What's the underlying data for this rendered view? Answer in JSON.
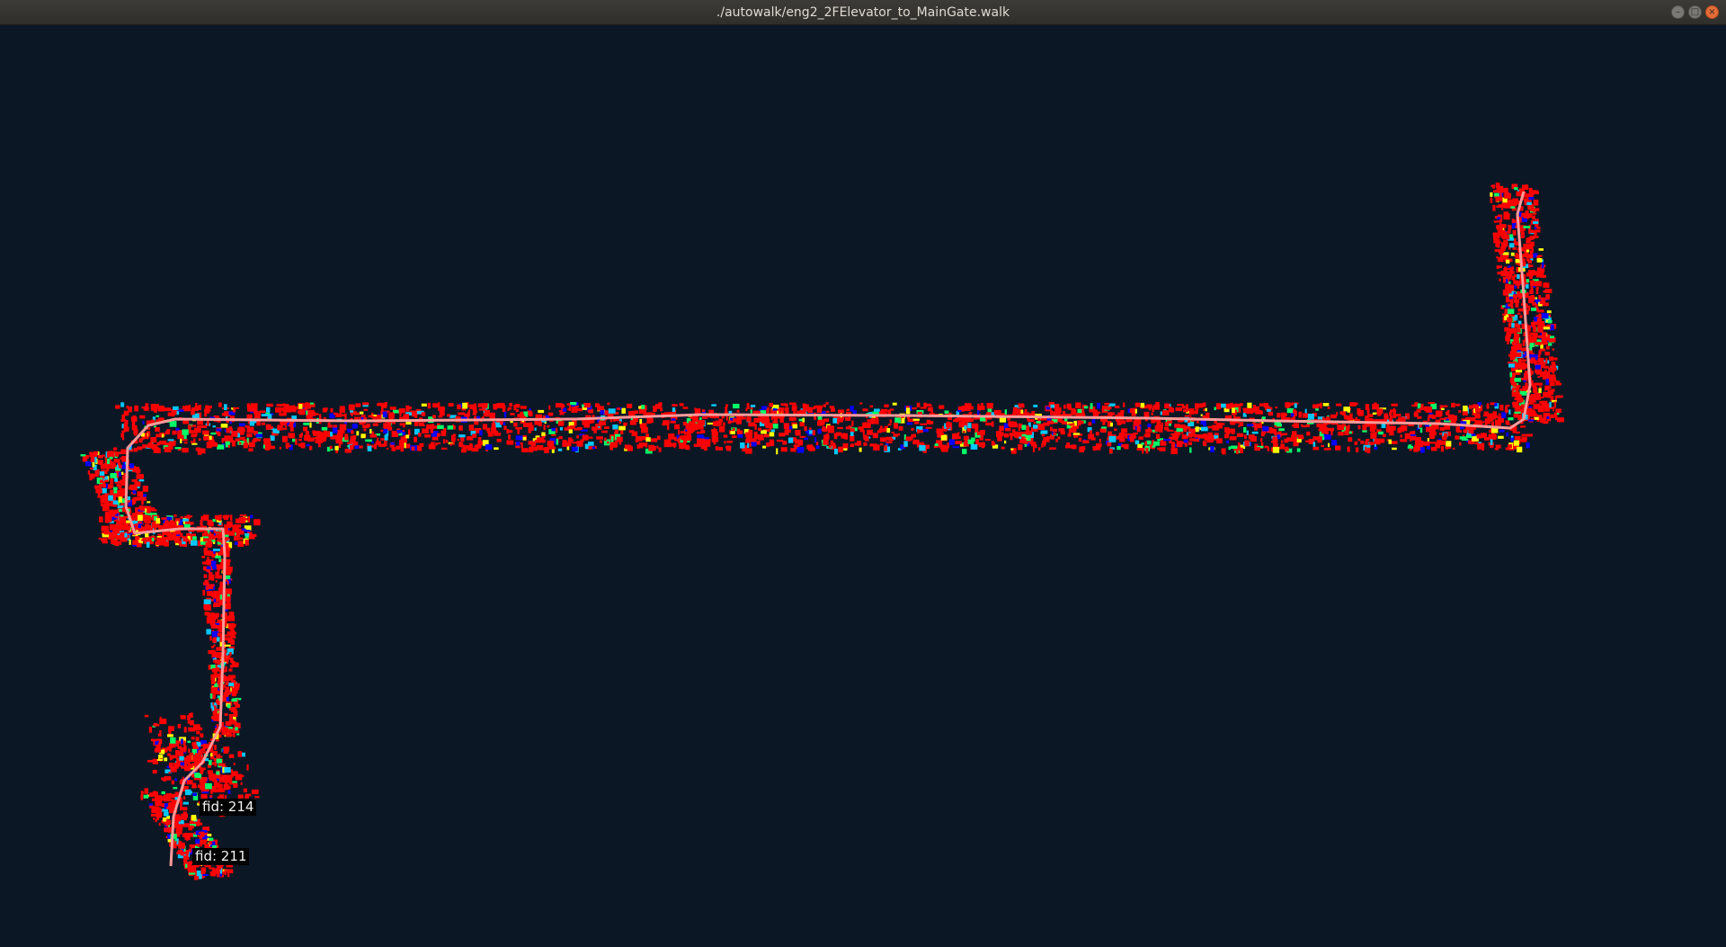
{
  "window": {
    "title": "./autowalk/eng2_2FElevator_to_MainGate.walk",
    "controls": {
      "minimize_icon": "minimize-icon",
      "maximize_icon": "maximize-icon",
      "close_icon": "close-icon",
      "minimize_glyph": "–",
      "maximize_glyph": "□",
      "close_glyph": "×"
    }
  },
  "map": {
    "background": "#0c1725",
    "point_colors": [
      "#ff0000",
      "#00c8ff",
      "#0000ff",
      "#00ff66",
      "#ffff00"
    ],
    "path_color": "#ff9a9a",
    "fiducials": [
      {
        "label": "fid: 214"
      },
      {
        "label": "fid: 211"
      }
    ]
  }
}
